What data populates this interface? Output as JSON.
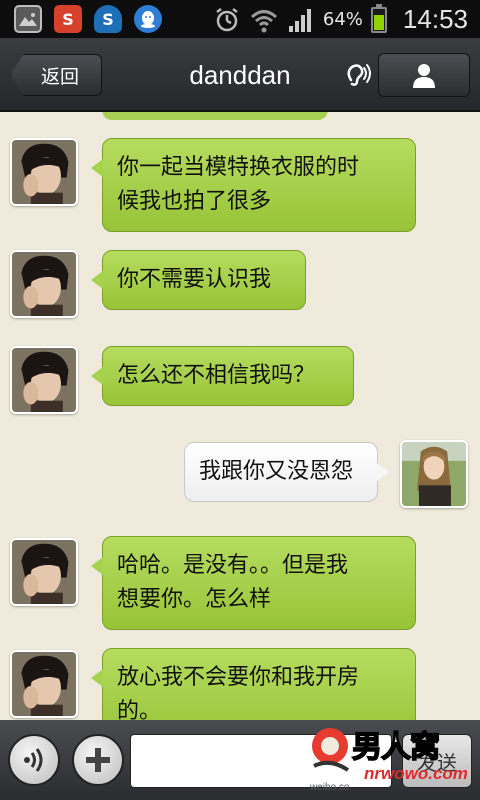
{
  "status_bar": {
    "battery_percent": "64%",
    "battery_level": 0.64,
    "time": "14:53",
    "weibo_icon_label": "S",
    "sync_icon_label": "S"
  },
  "header": {
    "back_label": "返回",
    "title": "danddan"
  },
  "messages": [
    {
      "side": "left",
      "text_line1": "你一起当模特换衣服的时",
      "text_line2": "候我也拍了很多"
    },
    {
      "side": "left",
      "text": "你不需要认识我"
    },
    {
      "side": "left",
      "text": "怎么还不相信我吗？"
    },
    {
      "side": "right",
      "text": "我跟你又没恩怨"
    },
    {
      "side": "left",
      "text_line1": "哈哈。是没有。。但是我",
      "text_line2": "想要你。怎么样"
    },
    {
      "side": "left",
      "text_line1": "放心我不会要你和我开房",
      "text_line2": "的。"
    }
  ],
  "input_bar": {
    "input_value": "",
    "send_label": "发送"
  },
  "watermark": {
    "brand": "男人窝",
    "url": "nrwowo.com",
    "small": "weibo.co"
  },
  "colors": {
    "incoming_bubble": "#a6d24c",
    "outgoing_bubble": "#ffffff",
    "chat_background": "#efeadb",
    "status_bar": "#0d0d0d",
    "title_bar": "#2f3235"
  }
}
